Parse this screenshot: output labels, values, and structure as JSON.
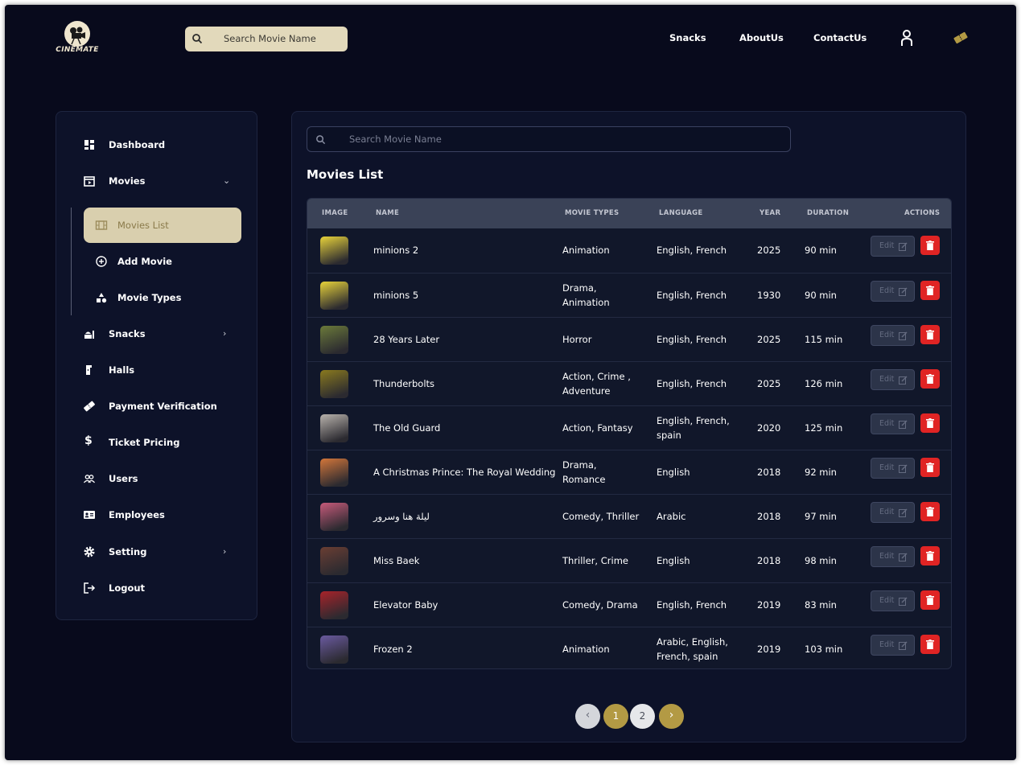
{
  "brand": {
    "logo_text": "CINEMATE"
  },
  "header": {
    "search_placeholder": "Search Movie Name",
    "nav": [
      "Snacks",
      "AboutUs",
      "ContactUs"
    ],
    "user_icon": "user-icon",
    "ticket_icon": "ticket-icon"
  },
  "sidebar": {
    "items": [
      {
        "label": "Dashboard",
        "icon": "dashboard-icon"
      },
      {
        "label": "Movies",
        "icon": "movies-icon"
      },
      {
        "label": "Snacks",
        "icon": "snacks-icon"
      },
      {
        "label": "Halls",
        "icon": "halls-icon"
      },
      {
        "label": "Payment Verification",
        "icon": "ticket-icon"
      },
      {
        "label": "Ticket Pricing",
        "icon": "dollar-icon"
      },
      {
        "label": "Users",
        "icon": "users-icon"
      },
      {
        "label": "Employees",
        "icon": "id-card-icon"
      },
      {
        "label": "Setting",
        "icon": "gear-icon"
      },
      {
        "label": "Logout",
        "icon": "logout-icon"
      }
    ],
    "sub_items": [
      {
        "label": "Movies List",
        "icon": "film-icon",
        "active": true
      },
      {
        "label": "Add Movie",
        "icon": "plus-circle-icon",
        "active": false
      },
      {
        "label": "Movie Types",
        "icon": "shapes-icon",
        "active": false
      }
    ]
  },
  "main": {
    "search_placeholder": "Search Movie Name",
    "title": "Movies List",
    "columns": [
      "IMAGE",
      "NAME",
      "MOVIE TYPES",
      "LANGUAGE",
      "YEAR",
      "DURATION",
      "ACTIONS"
    ],
    "edit_label": "Edit",
    "rows": [
      {
        "name": "minions 2",
        "types": [
          "Animation"
        ],
        "language": [
          "English, French"
        ],
        "year": "2025",
        "duration": "90 min",
        "thumb": "#e8d33a"
      },
      {
        "name": "minions 5",
        "types": [
          "Drama,",
          "Animation"
        ],
        "language": [
          "English, French"
        ],
        "year": "1930",
        "duration": "90 min",
        "thumb": "#e8d33a"
      },
      {
        "name": "28 Years Later",
        "types": [
          "Horror"
        ],
        "language": [
          "English, French"
        ],
        "year": "2025",
        "duration": "115 min",
        "thumb": "#6b7a3a"
      },
      {
        "name": "Thunderbolts",
        "types": [
          "Action, Crime ,",
          "Adventure"
        ],
        "language": [
          "English, French"
        ],
        "year": "2025",
        "duration": "126 min",
        "thumb": "#8a7a1e"
      },
      {
        "name": "The Old Guard",
        "types": [
          "Action, Fantasy"
        ],
        "language": [
          "English, French,",
          "spain"
        ],
        "year": "2020",
        "duration": "125 min",
        "thumb": "#b9b3ad"
      },
      {
        "name": "A Christmas Prince: The Royal Wedding",
        "types": [
          "Drama,",
          "Romance"
        ],
        "language": [
          "English"
        ],
        "year": "2018",
        "duration": "92 min",
        "thumb": "#d3763a"
      },
      {
        "name": "ليلة هنا وسرور",
        "types": [
          "Comedy, Thriller"
        ],
        "language": [
          "Arabic"
        ],
        "year": "2018",
        "duration": "97 min",
        "thumb": "#c65a7a"
      },
      {
        "name": "Miss Baek",
        "types": [
          "Thriller, Crime"
        ],
        "language": [
          "English"
        ],
        "year": "2018",
        "duration": "98 min",
        "thumb": "#6a3e33"
      },
      {
        "name": "Elevator Baby",
        "types": [
          "Comedy, Drama"
        ],
        "language": [
          "English, French"
        ],
        "year": "2019",
        "duration": "83 min",
        "thumb": "#a8232a"
      },
      {
        "name": "Frozen 2",
        "types": [
          "Animation"
        ],
        "language": [
          "Arabic, English,",
          "French, spain"
        ],
        "year": "2019",
        "duration": "103 min",
        "thumb": "#6a5aa0"
      }
    ]
  },
  "pagination": {
    "pages": [
      "1",
      "2"
    ],
    "current": "1"
  },
  "colors": {
    "accent_gold": "#b39a44",
    "beige": "#d9cfae",
    "danger": "#e02424",
    "background": "#080a1c"
  }
}
